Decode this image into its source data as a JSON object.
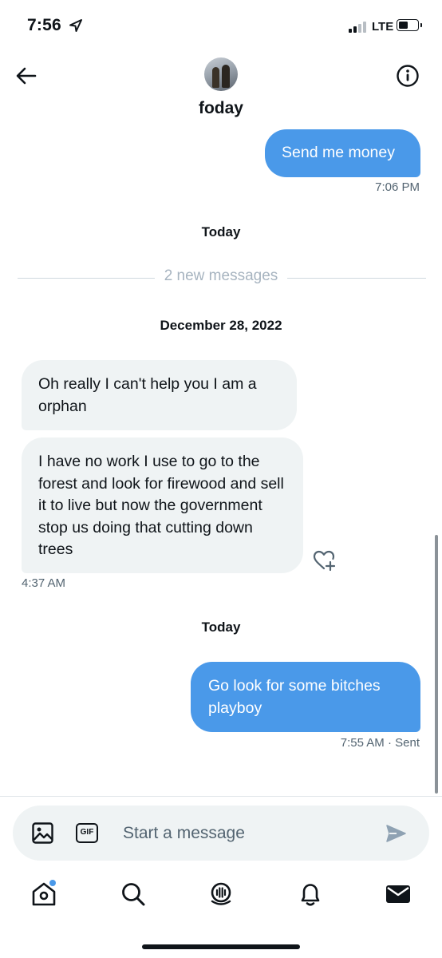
{
  "status_bar": {
    "time": "7:56",
    "network": "LTE",
    "signal_bars": 2,
    "battery_level": 0.45
  },
  "header": {
    "name": "foday",
    "back_icon": "arrow-left-icon",
    "info_icon": "info-circle-icon"
  },
  "messages": [
    {
      "type": "outgoing",
      "text": "Send me money",
      "time": "7:06 PM"
    },
    {
      "type": "date",
      "text": "Today"
    },
    {
      "type": "divider",
      "text": "2 new messages"
    },
    {
      "type": "date",
      "text": "December 28, 2022"
    },
    {
      "type": "incoming",
      "text": "Oh really I can't help you I am a orphan"
    },
    {
      "type": "incoming",
      "text": "I have no work I use to go to the forest and look for firewood and sell it to live but now the government stop us doing that cutting down trees",
      "time": "4:37 AM"
    },
    {
      "type": "date",
      "text": "Today"
    },
    {
      "type": "outgoing",
      "text": "Go look for some bitches playboy",
      "time": "7:55 AM",
      "status": "· Sent"
    }
  ],
  "composer": {
    "placeholder": "Start a message",
    "gif_label": "GIF"
  },
  "tabbar": {
    "items": [
      "home-icon",
      "search-icon",
      "spaces-icon",
      "notifications-icon",
      "messages-icon"
    ]
  },
  "colors": {
    "accent": "#4a99e9",
    "incoming_bubble": "#eff3f4",
    "text": "#0f1419",
    "muted": "#536471"
  }
}
